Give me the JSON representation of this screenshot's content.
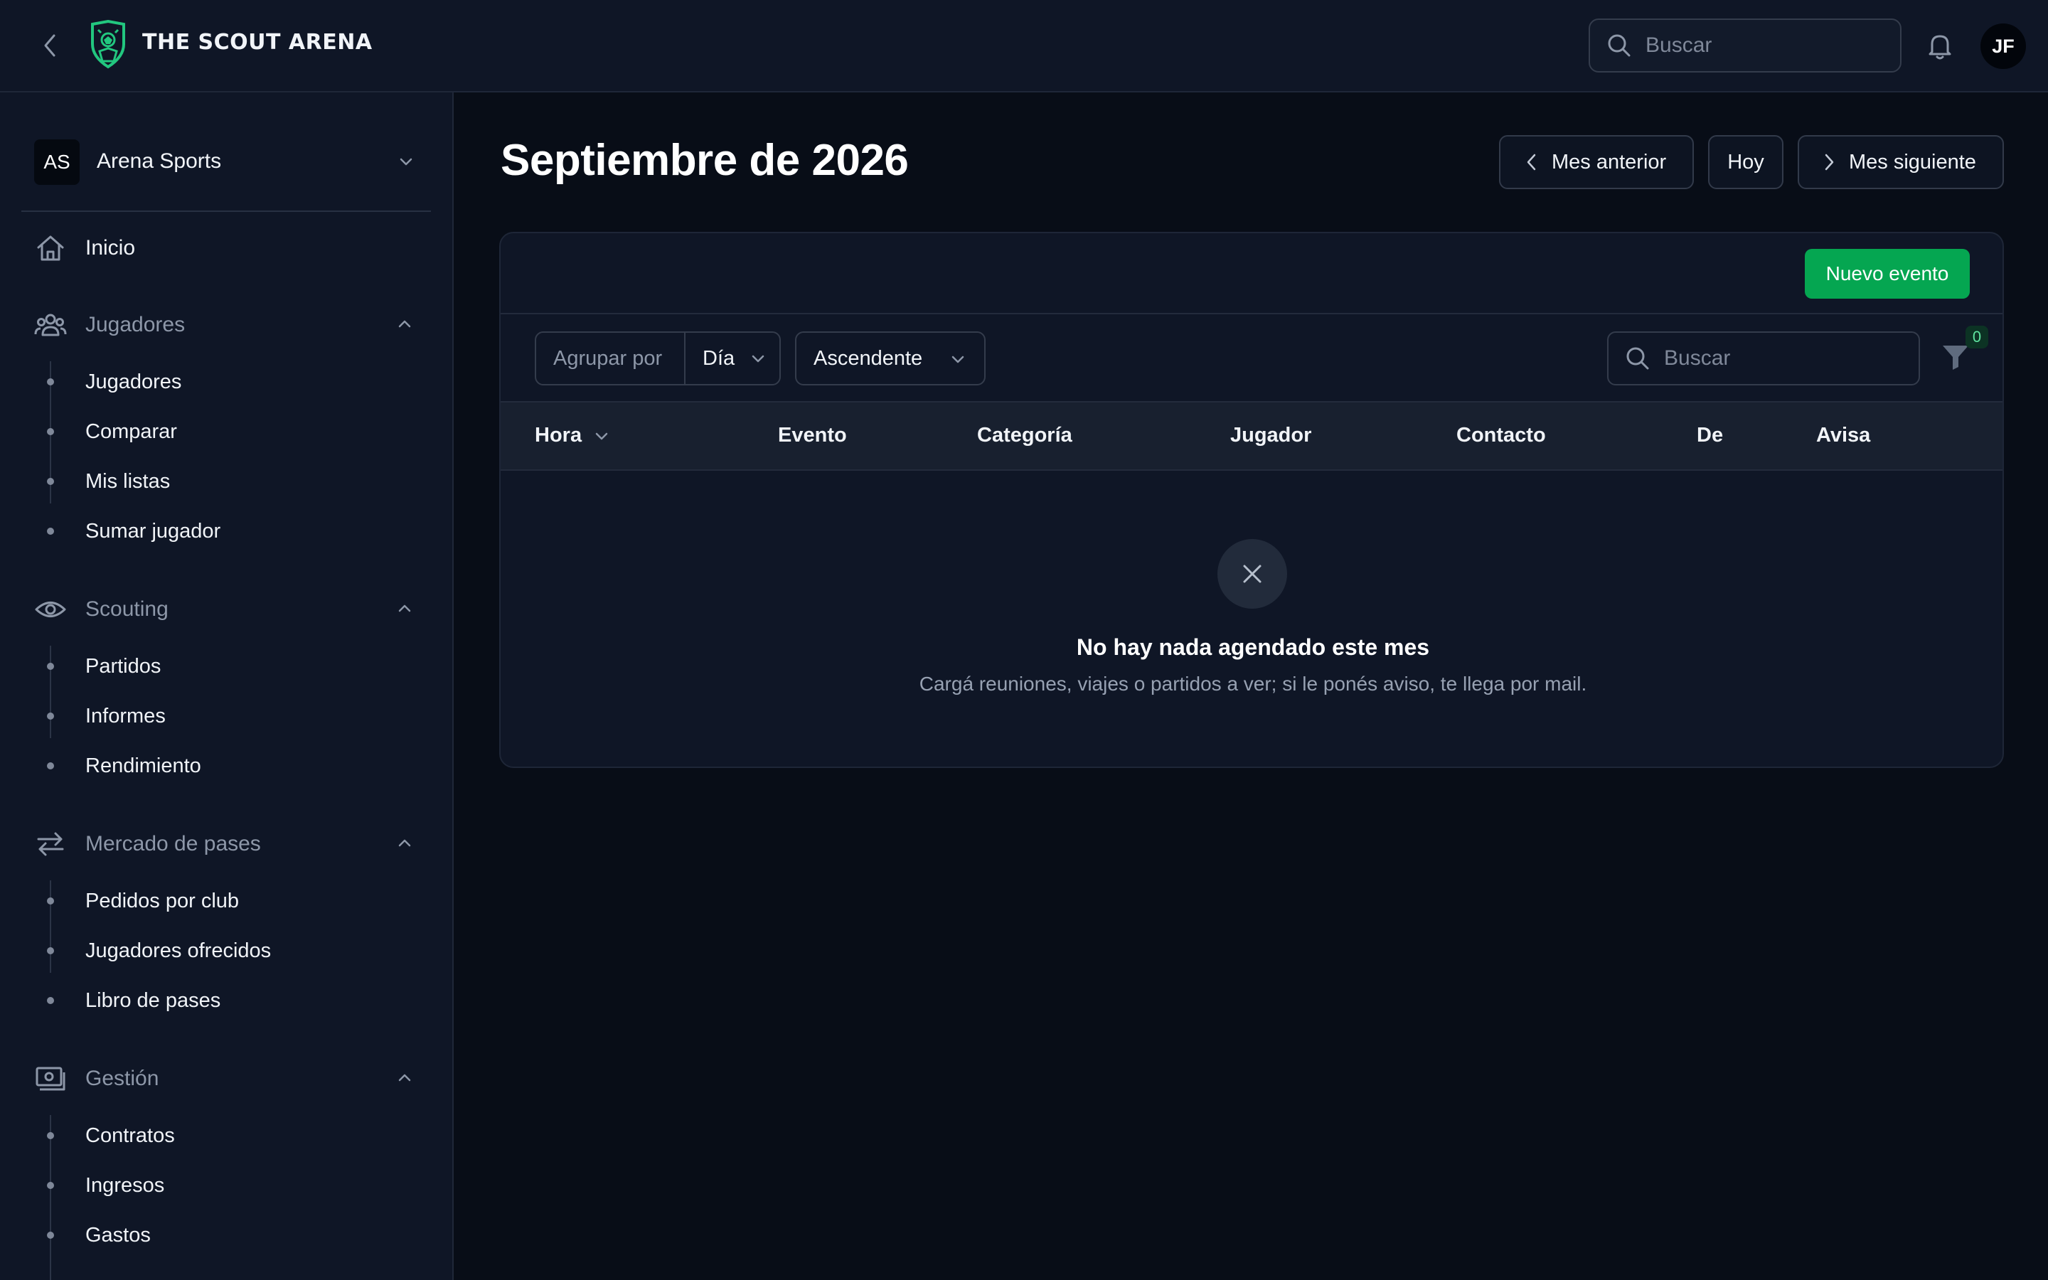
{
  "app": {
    "brand": "THE SCOUT ARENA"
  },
  "header": {
    "search_placeholder": "Buscar",
    "user_initials": "JF"
  },
  "sidebar": {
    "org": {
      "initials": "AS",
      "name": "Arena Sports"
    },
    "home": {
      "label": "Inicio",
      "icon": "home-icon"
    },
    "sections": [
      {
        "label": "Jugadores",
        "icon": "users-icon",
        "items": [
          "Jugadores",
          "Comparar",
          "Mis listas",
          "Sumar jugador"
        ]
      },
      {
        "label": "Scouting",
        "icon": "eye-icon",
        "items": [
          "Partidos",
          "Informes",
          "Rendimiento"
        ]
      },
      {
        "label": "Mercado de pases",
        "icon": "transfer-icon",
        "items": [
          "Pedidos por club",
          "Jugadores ofrecidos",
          "Libro de pases"
        ]
      },
      {
        "label": "Gestión",
        "icon": "money-icon",
        "items": [
          "Contratos",
          "Ingresos",
          "Gastos"
        ]
      }
    ]
  },
  "main": {
    "title": "Septiembre de 2026",
    "prev_label": "Mes anterior",
    "today_label": "Hoy",
    "next_label": "Mes siguiente",
    "new_event_label": "Nuevo evento",
    "group_by_label": "Agrupar por",
    "group_by_value": "Día",
    "sort_value": "Ascendente",
    "search_placeholder": "Buscar",
    "filter_count": "0",
    "columns": [
      "Hora",
      "Evento",
      "Categoría",
      "Jugador",
      "Contacto",
      "De",
      "Avisa"
    ],
    "empty": {
      "title": "No hay nada agendado este mes",
      "description": "Cargá reuniones, viajes o partidos a ver; si le ponés aviso, te llega por mail."
    }
  },
  "colors": {
    "accent": "#05a651",
    "background": "#080d17",
    "panel": "#0f1626"
  }
}
